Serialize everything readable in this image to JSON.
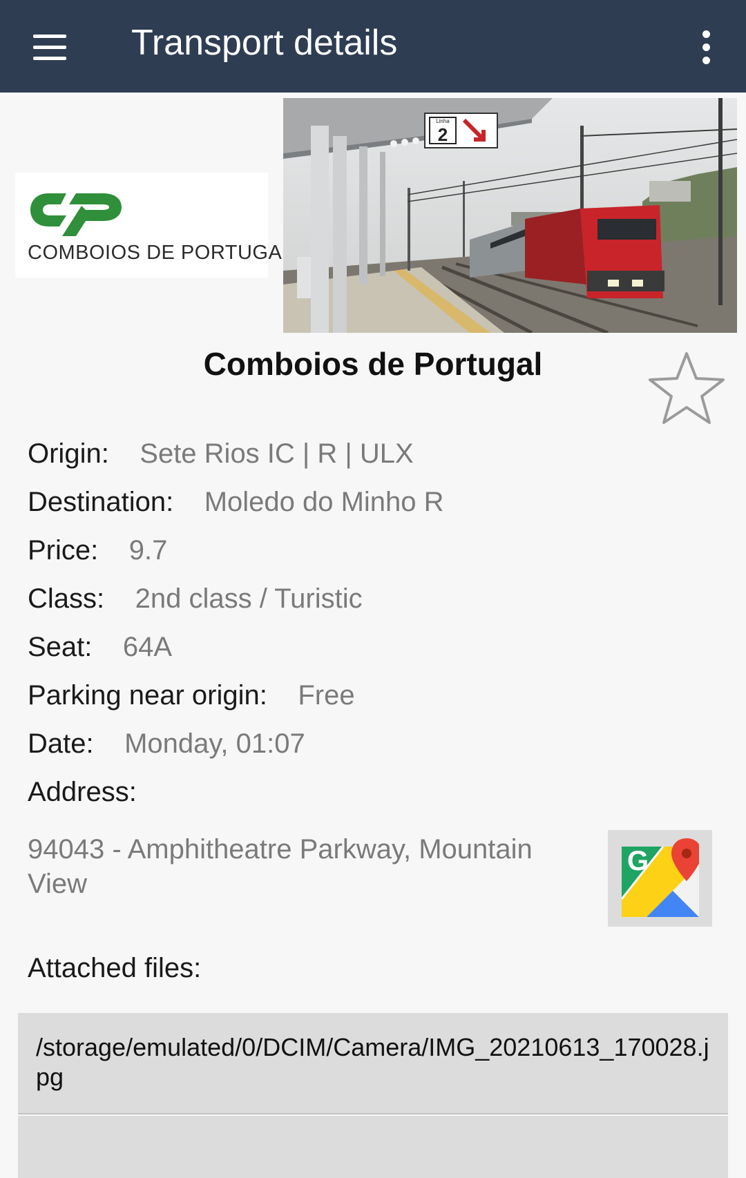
{
  "appbar": {
    "title": "Transport details"
  },
  "operator": {
    "name": "Comboios de Portugal",
    "logo_text": "COMBOIOS DE PORTUGAL",
    "brand_color": "#2f8f3a"
  },
  "details": [
    {
      "label": "Origin:",
      "value": "Sete Rios IC | R | ULX"
    },
    {
      "label": "Destination:",
      "value": "Moledo do Minho R"
    },
    {
      "label": "Price:",
      "value": "9.7"
    },
    {
      "label": "Class:",
      "value": "2nd class / Turistic"
    },
    {
      "label": "Seat:",
      "value": "64A"
    },
    {
      "label": "Parking near origin:",
      "value": "Free"
    },
    {
      "label": "Date:",
      "value": "Monday, 01:07"
    }
  ],
  "address": {
    "label": "Address:",
    "value": "94043 - Amphitheatre Parkway, Mountain View"
  },
  "attachments": {
    "label": "Attached files:",
    "files": [
      {
        "path": "/storage/emulated/0/DCIM/Camera/IMG_20210613_170028.jpg"
      }
    ]
  },
  "photo": {
    "sign_number": "2",
    "sign_label": "Linha"
  },
  "icons": {
    "menu": "menu-icon",
    "overflow": "more-vert-icon",
    "favorite": "star-outline-icon",
    "maps": "google-maps-icon"
  }
}
